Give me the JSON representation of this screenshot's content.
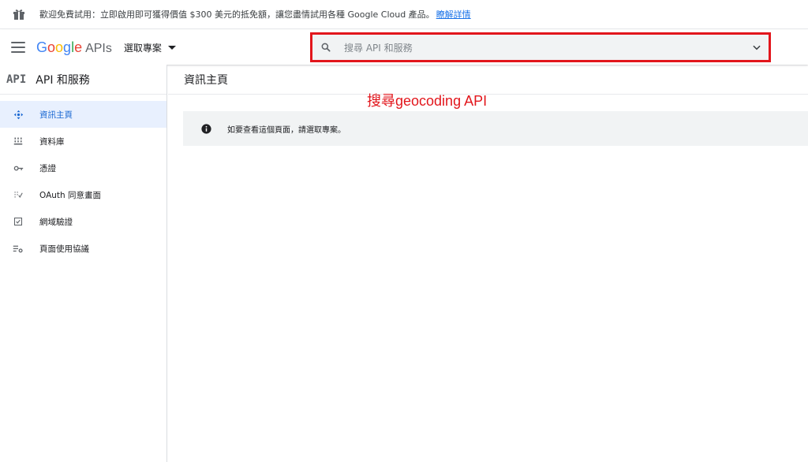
{
  "promo": {
    "icon": "gift-icon",
    "text": "歡迎免費試用：立即啟用即可獲得價值 $300 美元的抵免額，讓您盡情試用各種 Google Cloud 產品。",
    "link": "瞭解詳情"
  },
  "header": {
    "logo": {
      "letters": [
        "G",
        "o",
        "o",
        "g",
        "l",
        "e"
      ],
      "suffix": "APIs"
    },
    "project_label": "選取專案",
    "search_placeholder": "搜尋 API 和服務"
  },
  "sidebar": {
    "title": "API 和服務",
    "api_mark": "API",
    "items": [
      {
        "label": "資訊主頁",
        "icon": "dashboard-icon",
        "active": true
      },
      {
        "label": "資料庫",
        "icon": "library-icon",
        "active": false
      },
      {
        "label": "憑證",
        "icon": "key-icon",
        "active": false
      },
      {
        "label": "OAuth 同意畫面",
        "icon": "oauth-consent-icon",
        "active": false
      },
      {
        "label": "網域驗證",
        "icon": "domain-check-icon",
        "active": false
      },
      {
        "label": "頁面使用協議",
        "icon": "settings-list-icon",
        "active": false
      }
    ]
  },
  "main": {
    "page_title": "資訊主頁",
    "annotation": "搜尋geocoding API",
    "notice": "如要查看這個頁面，請選取專案。"
  },
  "colors": {
    "accent_blue": "#1a73e8",
    "highlight_red": "#e2161c",
    "active_bg": "#e8f0fe"
  }
}
